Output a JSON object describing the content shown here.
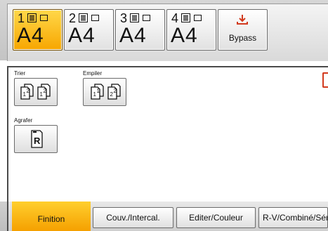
{
  "colors": {
    "selected_tray": "#f7a600",
    "active_tab": "#f5a000",
    "bypass_arrow": "#d23a1e",
    "panel_border": "#4a4a4a"
  },
  "trays": [
    {
      "number": "1",
      "paper": "A4",
      "selected": true
    },
    {
      "number": "2",
      "paper": "A4",
      "selected": false
    },
    {
      "number": "3",
      "paper": "A4",
      "selected": false
    },
    {
      "number": "4",
      "paper": "A4",
      "selected": false
    }
  ],
  "bypass": {
    "label": "Bypass",
    "icon": "download-arrow-icon"
  },
  "finishing": {
    "sort_label": "Trier",
    "stack_label": "Empiler",
    "staple_label": "Agrafer",
    "sort_icon": "sort-collate-icon",
    "stack_icon": "stack-offset-icon",
    "staple_icon": "staple-icon"
  },
  "tabs": [
    {
      "label": "Finition",
      "active": true
    },
    {
      "label": "Couv./Intercal.",
      "active": false
    },
    {
      "label": "Editer/Couleur",
      "active": false
    },
    {
      "label": "R-V/Combiné/Séri",
      "active": false
    }
  ]
}
